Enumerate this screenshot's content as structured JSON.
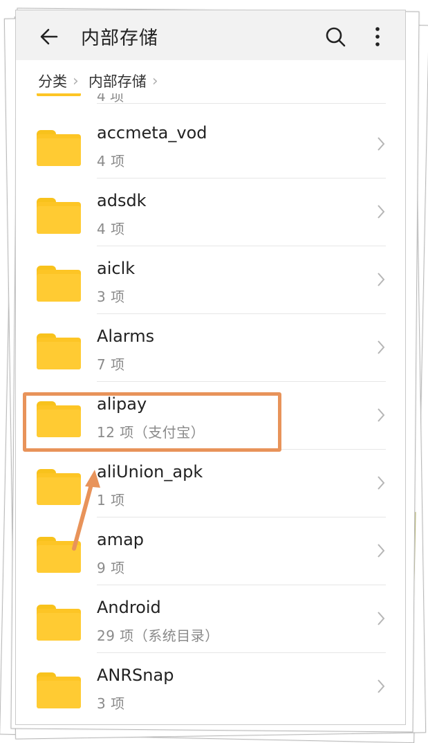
{
  "header": {
    "title": "内部存储",
    "back_icon": "arrow-left-icon",
    "search_icon": "search-icon",
    "more_icon": "more-vertical-icon"
  },
  "breadcrumb": {
    "items": [
      "分类",
      "内部存储"
    ]
  },
  "partial_row": {
    "sub": "4 项"
  },
  "folders": [
    {
      "name": "accmeta_vod",
      "sub": "4 项"
    },
    {
      "name": "adsdk",
      "sub": "4 项"
    },
    {
      "name": "aiclk",
      "sub": "3 项"
    },
    {
      "name": "Alarms",
      "sub": "7 项"
    },
    {
      "name": "alipay",
      "sub": "12 项（支付宝）"
    },
    {
      "name": "aliUnion_apk",
      "sub": "1 项"
    },
    {
      "name": "amap",
      "sub": "9 项"
    },
    {
      "name": "Android",
      "sub": "29 项（系统目录）"
    },
    {
      "name": "ANRSnap",
      "sub": "3 项"
    }
  ],
  "colors": {
    "folder": "#fdc525",
    "annotation": "#e8935a",
    "topbar": "#f2f2f2"
  }
}
